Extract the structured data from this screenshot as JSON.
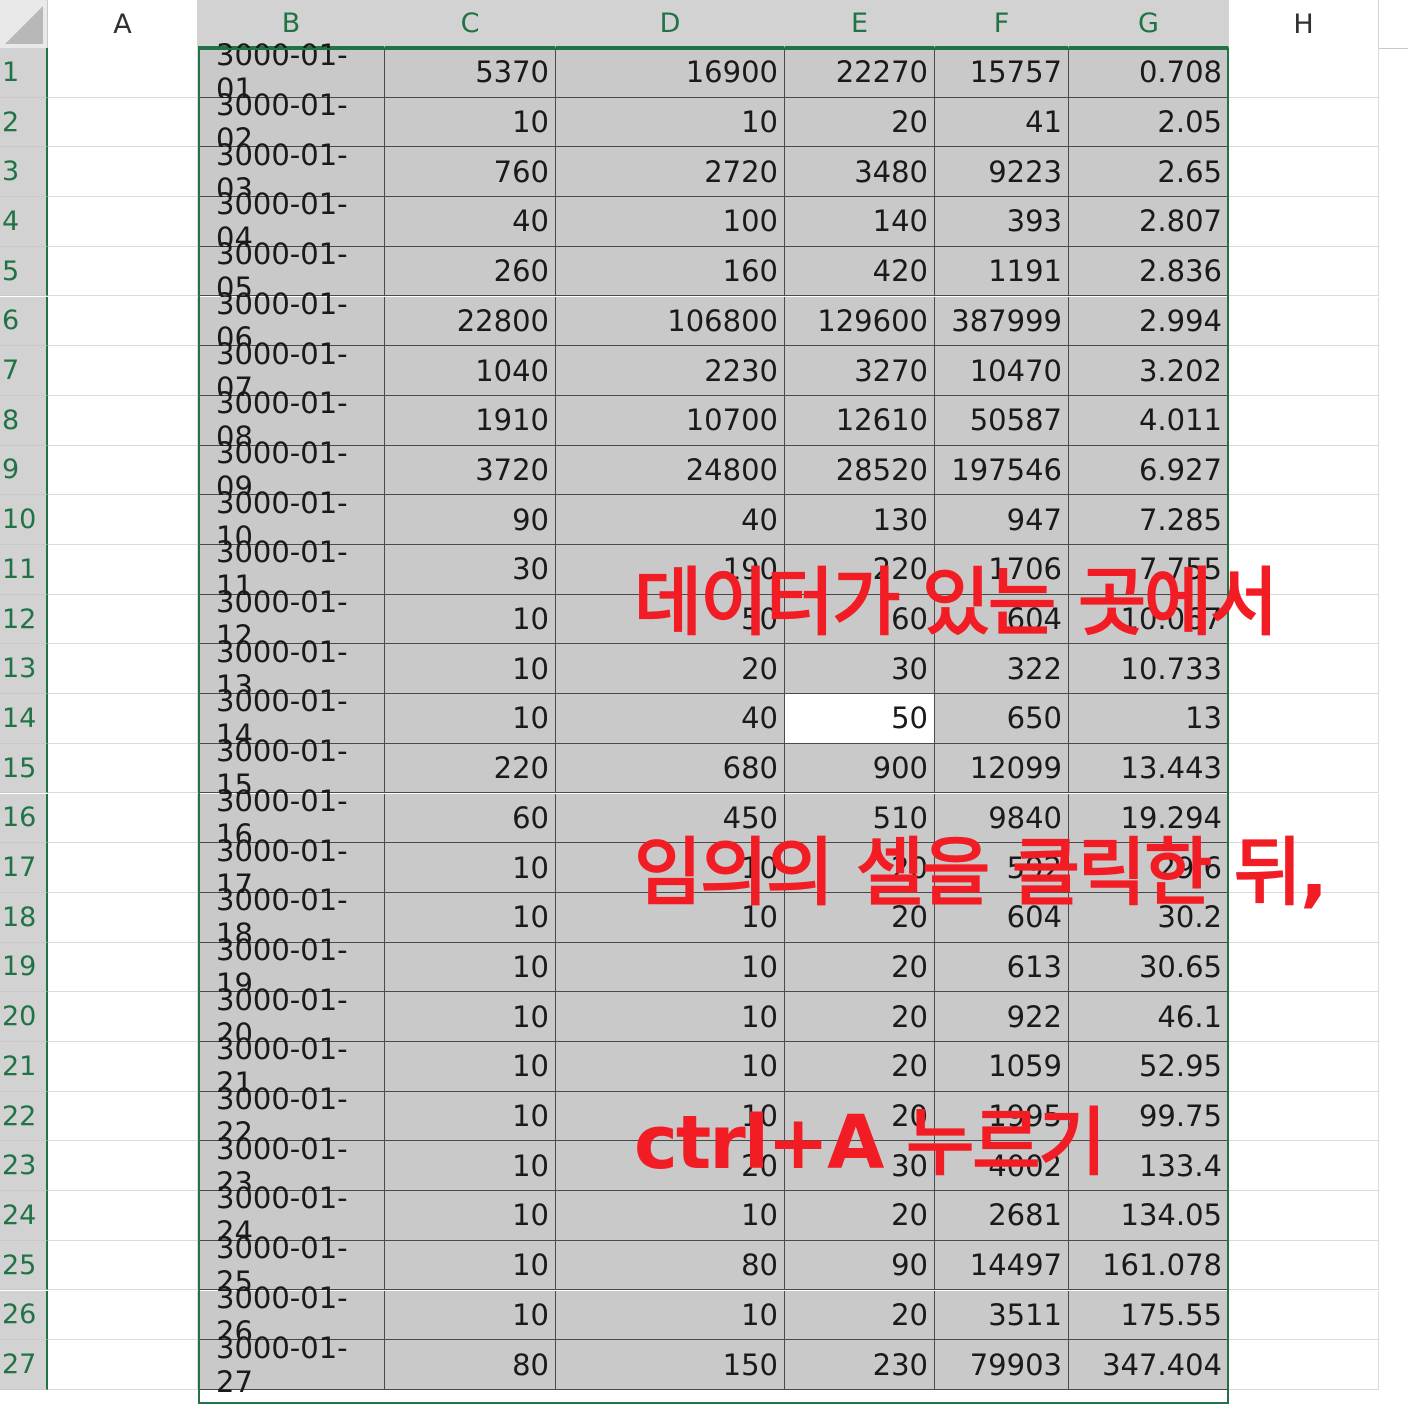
{
  "columns": [
    "A",
    "B",
    "C",
    "D",
    "E",
    "F",
    "G",
    "H"
  ],
  "selected_columns": [
    "B",
    "C",
    "D",
    "E",
    "F",
    "G"
  ],
  "active_cell": "E14",
  "rows": [
    {
      "n": "1",
      "date": "3000-01-01",
      "c": "5370",
      "d": "16900",
      "e": "22270",
      "f": "15757",
      "g": "0.708"
    },
    {
      "n": "2",
      "date": "3000-01-02",
      "c": "10",
      "d": "10",
      "e": "20",
      "f": "41",
      "g": "2.05"
    },
    {
      "n": "3",
      "date": "3000-01-03",
      "c": "760",
      "d": "2720",
      "e": "3480",
      "f": "9223",
      "g": "2.65"
    },
    {
      "n": "4",
      "date": "3000-01-04",
      "c": "40",
      "d": "100",
      "e": "140",
      "f": "393",
      "g": "2.807"
    },
    {
      "n": "5",
      "date": "3000-01-05",
      "c": "260",
      "d": "160",
      "e": "420",
      "f": "1191",
      "g": "2.836"
    },
    {
      "n": "6",
      "date": "3000-01-06",
      "c": "22800",
      "d": "106800",
      "e": "129600",
      "f": "387999",
      "g": "2.994"
    },
    {
      "n": "7",
      "date": "3000-01-07",
      "c": "1040",
      "d": "2230",
      "e": "3270",
      "f": "10470",
      "g": "3.202"
    },
    {
      "n": "8",
      "date": "3000-01-08",
      "c": "1910",
      "d": "10700",
      "e": "12610",
      "f": "50587",
      "g": "4.011"
    },
    {
      "n": "9",
      "date": "3000-01-09",
      "c": "3720",
      "d": "24800",
      "e": "28520",
      "f": "197546",
      "g": "6.927"
    },
    {
      "n": "10",
      "date": "3000-01-10",
      "c": "90",
      "d": "40",
      "e": "130",
      "f": "947",
      "g": "7.285"
    },
    {
      "n": "11",
      "date": "3000-01-11",
      "c": "30",
      "d": "190",
      "e": "220",
      "f": "1706",
      "g": "7.755"
    },
    {
      "n": "12",
      "date": "3000-01-12",
      "c": "10",
      "d": "50",
      "e": "60",
      "f": "604",
      "g": "10.067"
    },
    {
      "n": "13",
      "date": "3000-01-13",
      "c": "10",
      "d": "20",
      "e": "30",
      "f": "322",
      "g": "10.733"
    },
    {
      "n": "14",
      "date": "3000-01-14",
      "c": "10",
      "d": "40",
      "e": "50",
      "f": "650",
      "g": "13"
    },
    {
      "n": "15",
      "date": "3000-01-15",
      "c": "220",
      "d": "680",
      "e": "900",
      "f": "12099",
      "g": "13.443"
    },
    {
      "n": "16",
      "date": "3000-01-16",
      "c": "60",
      "d": "450",
      "e": "510",
      "f": "9840",
      "g": "19.294"
    },
    {
      "n": "17",
      "date": "3000-01-17",
      "c": "10",
      "d": "10",
      "e": "20",
      "f": "592",
      "g": "29.6"
    },
    {
      "n": "18",
      "date": "3000-01-18",
      "c": "10",
      "d": "10",
      "e": "20",
      "f": "604",
      "g": "30.2"
    },
    {
      "n": "19",
      "date": "3000-01-19",
      "c": "10",
      "d": "10",
      "e": "20",
      "f": "613",
      "g": "30.65"
    },
    {
      "n": "20",
      "date": "3000-01-20",
      "c": "10",
      "d": "10",
      "e": "20",
      "f": "922",
      "g": "46.1"
    },
    {
      "n": "21",
      "date": "3000-01-21",
      "c": "10",
      "d": "10",
      "e": "20",
      "f": "1059",
      "g": "52.95"
    },
    {
      "n": "22",
      "date": "3000-01-22",
      "c": "10",
      "d": "10",
      "e": "20",
      "f": "1995",
      "g": "99.75"
    },
    {
      "n": "23",
      "date": "3000-01-23",
      "c": "10",
      "d": "20",
      "e": "30",
      "f": "4002",
      "g": "133.4"
    },
    {
      "n": "24",
      "date": "3000-01-24",
      "c": "10",
      "d": "10",
      "e": "20",
      "f": "2681",
      "g": "134.05"
    },
    {
      "n": "25",
      "date": "3000-01-25",
      "c": "10",
      "d": "80",
      "e": "90",
      "f": "14497",
      "g": "161.078"
    },
    {
      "n": "26",
      "date": "3000-01-26",
      "c": "10",
      "d": "10",
      "e": "20",
      "f": "3511",
      "g": "175.55"
    },
    {
      "n": "27",
      "date": "3000-01-27",
      "c": "80",
      "d": "150",
      "e": "230",
      "f": "79903",
      "g": "347.404"
    }
  ],
  "annotation": {
    "line1": "데이터가 있는 곳에서",
    "line2": "임의의 셀을 클릭한 뒤,",
    "line3": "ctrl+A 누르기",
    "color": "#f21c24"
  }
}
